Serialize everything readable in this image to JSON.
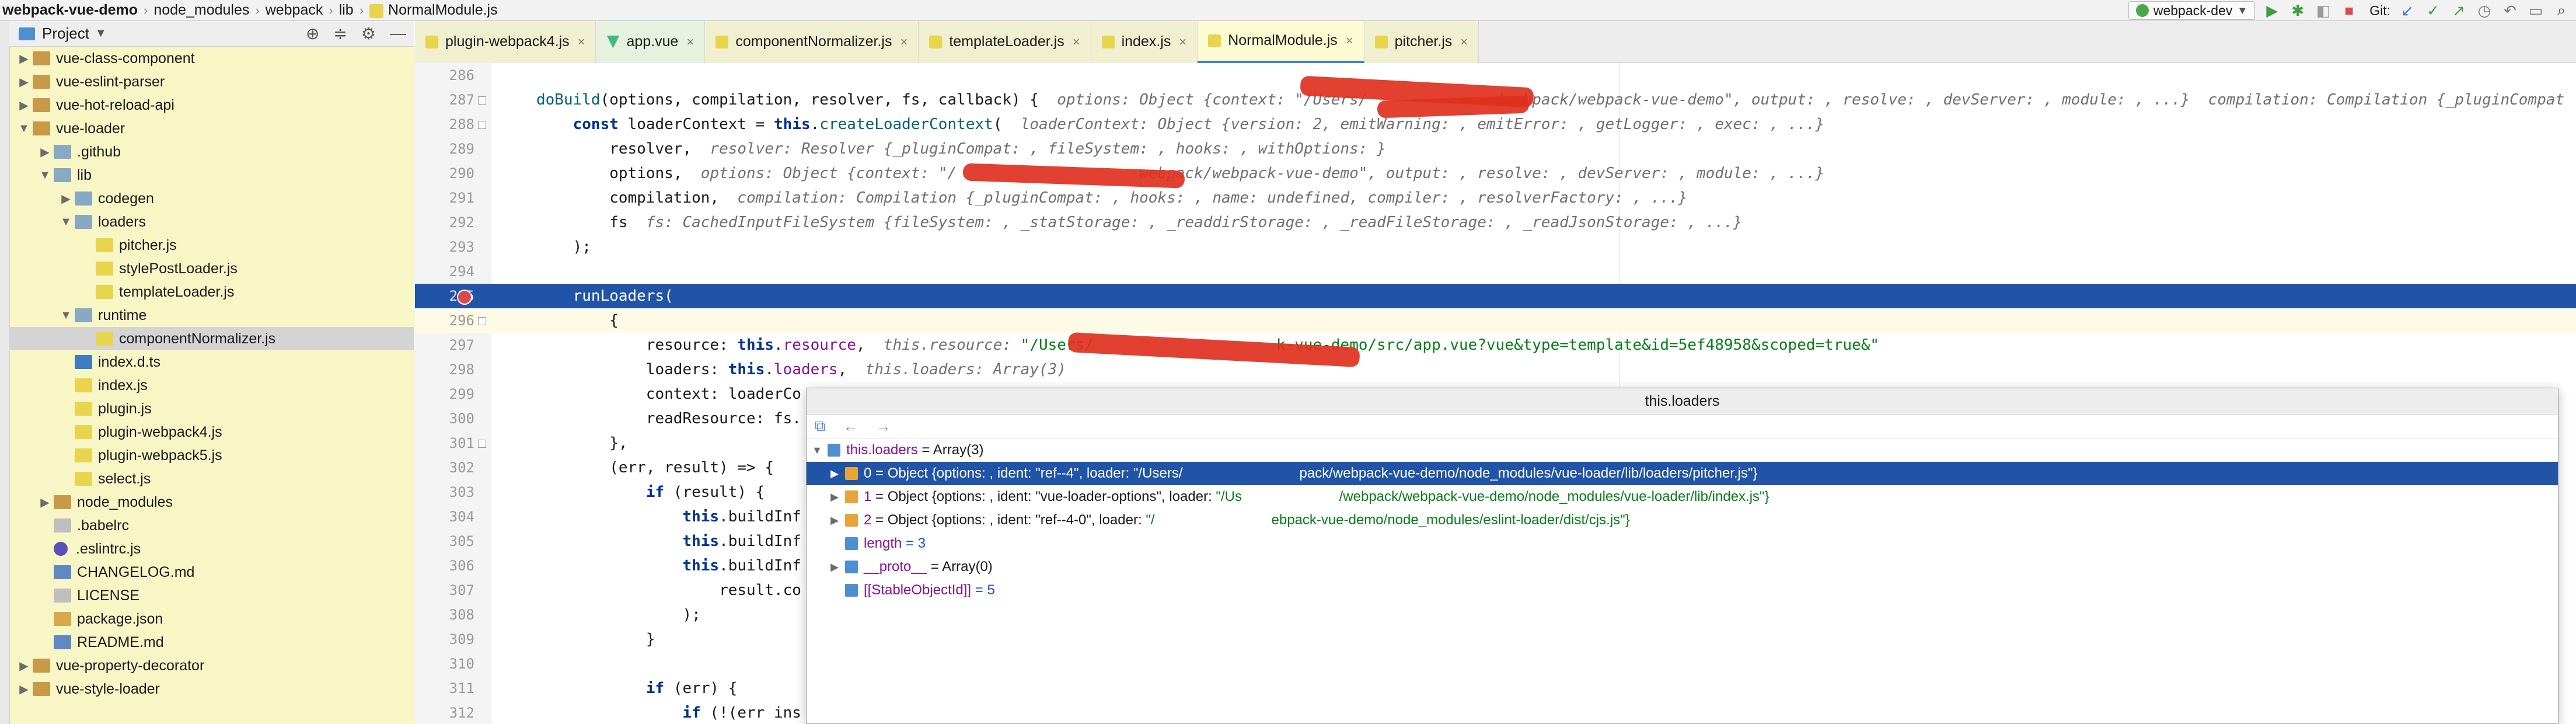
{
  "breadcrumb": [
    "webpack-vue-demo",
    "node_modules",
    "webpack",
    "lib",
    "NormalModule.js"
  ],
  "toolbar": {
    "run_config": "webpack-dev",
    "git_label": "Git:",
    "icons": [
      "run-icon",
      "debug-icon",
      "coverage-icon",
      "stop-icon",
      "git-update-icon",
      "git-commit-icon",
      "git-history-icon",
      "git-rollback-icon",
      "window-icon",
      "search-icon"
    ]
  },
  "project": {
    "title": "Project",
    "tree": [
      {
        "label": "vue-class-component",
        "type": "folder-brown",
        "arrow": "▶"
      },
      {
        "label": "vue-eslint-parser",
        "type": "folder-brown",
        "arrow": "▶"
      },
      {
        "label": "vue-hot-reload-api",
        "type": "folder-brown",
        "arrow": "▶"
      },
      {
        "label": "vue-loader",
        "type": "folder-brown",
        "arrow": "▼"
      },
      {
        "label": ".github",
        "type": "folder",
        "arrow": "▶"
      },
      {
        "label": "lib",
        "type": "folder",
        "arrow": "▼"
      },
      {
        "label": "codegen",
        "type": "folder",
        "arrow": "▶"
      },
      {
        "label": "loaders",
        "type": "folder",
        "arrow": "▼"
      },
      {
        "label": "pitcher.js",
        "type": "js",
        "arrow": ""
      },
      {
        "label": "stylePostLoader.js",
        "type": "js",
        "arrow": ""
      },
      {
        "label": "templateLoader.js",
        "type": "js",
        "arrow": ""
      },
      {
        "label": "runtime",
        "type": "folder",
        "arrow": "▼"
      },
      {
        "label": "componentNormalizer.js",
        "type": "js",
        "arrow": ""
      },
      {
        "label": "index.d.ts",
        "type": "ts",
        "arrow": ""
      },
      {
        "label": "index.js",
        "type": "js",
        "arrow": ""
      },
      {
        "label": "plugin.js",
        "type": "js",
        "arrow": ""
      },
      {
        "label": "plugin-webpack4.js",
        "type": "js",
        "arrow": ""
      },
      {
        "label": "plugin-webpack5.js",
        "type": "js",
        "arrow": ""
      },
      {
        "label": "select.js",
        "type": "js",
        "arrow": ""
      },
      {
        "label": "node_modules",
        "type": "folder-brown",
        "arrow": "▶"
      },
      {
        "label": ".babelrc",
        "type": "plain",
        "arrow": ""
      },
      {
        "label": ".eslintrc.js",
        "type": "eslint",
        "arrow": ""
      },
      {
        "label": "CHANGELOG.md",
        "type": "md",
        "arrow": ""
      },
      {
        "label": "LICENSE",
        "type": "plain",
        "arrow": ""
      },
      {
        "label": "package.json",
        "type": "json",
        "arrow": ""
      },
      {
        "label": "README.md",
        "type": "md",
        "arrow": ""
      },
      {
        "label": "vue-property-decorator",
        "type": "folder-brown",
        "arrow": "▶"
      },
      {
        "label": "vue-style-loader",
        "type": "folder-brown",
        "arrow": "▶"
      }
    ]
  },
  "tabs": [
    {
      "label": "plugin-webpack4.js",
      "kind": "js",
      "active": false
    },
    {
      "label": "app.vue",
      "kind": "vue",
      "active": false
    },
    {
      "label": "componentNormalizer.js",
      "kind": "js",
      "active": false
    },
    {
      "label": "templateLoader.js",
      "kind": "js",
      "active": false
    },
    {
      "label": "index.js",
      "kind": "js",
      "active": false
    },
    {
      "label": "NormalModule.js",
      "kind": "js",
      "active": true
    },
    {
      "label": "pitcher.js",
      "kind": "js",
      "active": false
    }
  ],
  "tab_close_glyph": "×",
  "code_lines": [
    {
      "num": "286",
      "segs": [
        [
          "",
          ""
        ]
      ]
    },
    {
      "num": "287",
      "segs": [
        [
          "fn",
          "doBuild"
        ],
        [
          "",
          "(options, compilation, resolver, fs, callback) {  "
        ],
        [
          "hint",
          "options: Object {context: \"/Users/              /webpack/webpack-vue-demo\", output: , resolve: , devServer: , module: , ...}  compilation: Compilation {_pluginCompat"
        ]
      ]
    },
    {
      "num": "288",
      "segs": [
        [
          "",
          "    "
        ],
        [
          "kw",
          "const"
        ],
        [
          "",
          " loaderContext = "
        ],
        [
          "kw",
          "this"
        ],
        [
          "",
          "."
        ],
        [
          "fn",
          "createLoaderContext"
        ],
        [
          "",
          "(  "
        ],
        [
          "hint",
          "loaderContext: Object {version: 2, emitWarning: , emitError: , getLogger: , exec: , ...}"
        ]
      ]
    },
    {
      "num": "289",
      "segs": [
        [
          "",
          "        resolver,  "
        ],
        [
          "hint",
          "resolver: Resolver {_pluginCompat: , fileSystem: , hooks: , withOptions: }"
        ]
      ]
    },
    {
      "num": "290",
      "segs": [
        [
          "",
          "        options,  "
        ],
        [
          "hint",
          "options: Object {context: \"/                    webpack/webpack-vue-demo\", output: , resolve: , devServer: , module: , ...}"
        ]
      ]
    },
    {
      "num": "291",
      "segs": [
        [
          "",
          "        compilation,  "
        ],
        [
          "hint",
          "compilation: Compilation {_pluginCompat: , hooks: , name: undefined, compiler: , resolverFactory: , ...}"
        ]
      ]
    },
    {
      "num": "292",
      "segs": [
        [
          "",
          "        fs  "
        ],
        [
          "hint",
          "fs: CachedInputFileSystem {fileSystem: , _statStorage: , _readdirStorage: , _readFileStorage: , _readJsonStorage: , ...}"
        ]
      ]
    },
    {
      "num": "293",
      "segs": [
        [
          "",
          "    );"
        ]
      ]
    },
    {
      "num": "294",
      "segs": [
        [
          "",
          ""
        ]
      ]
    },
    {
      "num": "295",
      "segs": [
        [
          "",
          "    runLoaders("
        ]
      ],
      "highlight": true,
      "breakpoint": true
    },
    {
      "num": "296",
      "segs": [
        [
          "",
          "        {"
        ]
      ],
      "cursor": true
    },
    {
      "num": "297",
      "segs": [
        [
          "",
          "            resource: "
        ],
        [
          "kw",
          "this"
        ],
        [
          "",
          "."
        ],
        [
          "prop",
          "resource"
        ],
        [
          "",
          ",  "
        ],
        [
          "hint",
          "this.resource: "
        ],
        [
          "str",
          "\"/Users/                    k-vue-demo/src/app.vue?vue&type=template&id=5ef48958&scoped=true&\""
        ]
      ]
    },
    {
      "num": "298",
      "segs": [
        [
          "",
          "            loaders: "
        ],
        [
          "kw",
          "this"
        ],
        [
          "",
          "."
        ],
        [
          "prop",
          "loaders"
        ],
        [
          "",
          ",  "
        ],
        [
          "hint",
          "this.loaders: Array(3)"
        ]
      ]
    },
    {
      "num": "299",
      "segs": [
        [
          "",
          "            context: loaderCo"
        ]
      ]
    },
    {
      "num": "300",
      "segs": [
        [
          "",
          "            readResource: fs."
        ]
      ]
    },
    {
      "num": "301",
      "segs": [
        [
          "",
          "        },"
        ]
      ]
    },
    {
      "num": "302",
      "segs": [
        [
          "",
          "        (err, result) => {"
        ]
      ]
    },
    {
      "num": "303",
      "segs": [
        [
          "",
          "            "
        ],
        [
          "kw",
          "if"
        ],
        [
          "",
          " (result) {"
        ]
      ]
    },
    {
      "num": "304",
      "segs": [
        [
          "",
          "                "
        ],
        [
          "kw",
          "this"
        ],
        [
          "",
          ".buildInf"
        ]
      ]
    },
    {
      "num": "305",
      "segs": [
        [
          "",
          "                "
        ],
        [
          "kw",
          "this"
        ],
        [
          "",
          ".buildInf"
        ]
      ]
    },
    {
      "num": "306",
      "segs": [
        [
          "",
          "                "
        ],
        [
          "kw",
          "this"
        ],
        [
          "",
          ".buildInf"
        ]
      ]
    },
    {
      "num": "307",
      "segs": [
        [
          "",
          "                    result.co"
        ]
      ]
    },
    {
      "num": "308",
      "segs": [
        [
          "",
          "                );"
        ]
      ]
    },
    {
      "num": "309",
      "segs": [
        [
          "",
          "            }"
        ]
      ]
    },
    {
      "num": "310",
      "segs": [
        [
          "",
          ""
        ]
      ]
    },
    {
      "num": "311",
      "segs": [
        [
          "",
          "            "
        ],
        [
          "kw",
          "if"
        ],
        [
          "",
          " (err) {"
        ]
      ]
    },
    {
      "num": "312",
      "segs": [
        [
          "",
          "                "
        ],
        [
          "kw",
          "if"
        ],
        [
          "",
          " (!(err ins"
        ]
      ]
    }
  ],
  "popup": {
    "title": "this.loaders",
    "toolbar_icons": [
      "inspect-icon",
      "back-icon",
      "forward-icon"
    ],
    "rows": [
      {
        "indent": 0,
        "arrow": "▼",
        "icon": "arr",
        "key": "this.loaders",
        "val": " = Array(3)",
        "str": "",
        "selected": false
      },
      {
        "indent": 1,
        "arrow": "▶",
        "icon": "obj",
        "key": "0",
        "val": " = Object {options: , ident: \"ref--4\", loader: ",
        "str": "\"/Users/                              pack/webpack-vue-demo/node_modules/vue-loader/lib/loaders/pitcher.js\"}",
        "selected": true
      },
      {
        "indent": 1,
        "arrow": "▶",
        "icon": "obj",
        "key": "1",
        "val": " = Object {options: , ident: \"vue-loader-options\", loader: ",
        "str": "\"/Us                         /webpack/webpack-vue-demo/node_modules/vue-loader/lib/index.js\"}",
        "selected": false
      },
      {
        "indent": 1,
        "arrow": "▶",
        "icon": "obj",
        "key": "2",
        "val": " = Object {options: , ident: \"ref--4-0\", loader: ",
        "str": "\"/                              ebpack-vue-demo/node_modules/eslint-loader/dist/cjs.js\"}",
        "selected": false
      },
      {
        "indent": 1,
        "arrow": "",
        "icon": "num",
        "key": "length",
        "val": " = 3",
        "str": "",
        "selected": false
      },
      {
        "indent": 1,
        "arrow": "▶",
        "icon": "arr",
        "key": "__proto__",
        "val": " = Array(0)",
        "str": "",
        "selected": false
      },
      {
        "indent": 1,
        "arrow": "",
        "icon": "num",
        "key": "[[StableObjectId]]",
        "val": " = 5",
        "str": "",
        "selected": false
      }
    ]
  },
  "colors": {
    "selection": "#2154a6",
    "project_bg": "#f9f6c6",
    "redaction": "#e0301e"
  }
}
